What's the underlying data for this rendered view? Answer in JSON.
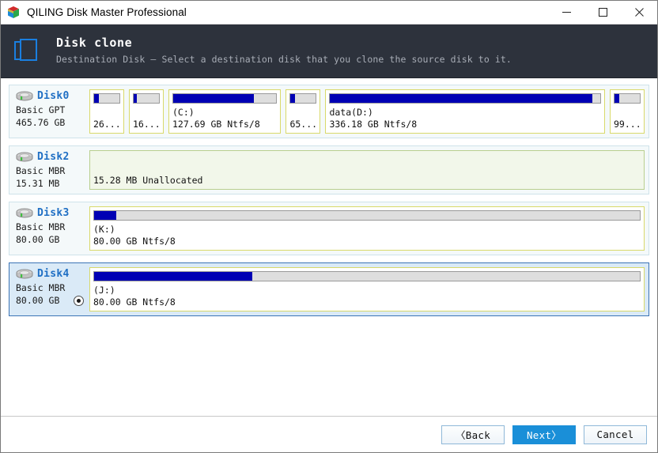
{
  "window": {
    "title": "QILING Disk Master Professional",
    "app_icon": "cube-icon",
    "controls": {
      "minimize": "minimize-icon",
      "maximize": "maximize-icon",
      "close": "close-icon"
    }
  },
  "header": {
    "icon": "disk-clone-icon",
    "title": "Disk clone",
    "subtitle": "Destination Disk – Select a destination disk that you clone the source disk to it."
  },
  "disks": [
    {
      "name": "Disk0",
      "type": "Basic GPT",
      "size": "465.76 GB",
      "selected": false,
      "has_radio": false,
      "partitions": [
        {
          "label": "",
          "size": "26...",
          "used_pct": 18,
          "truncated": true,
          "unallocated": false,
          "flex": "small"
        },
        {
          "label": "",
          "size": "16...",
          "used_pct": 14,
          "truncated": true,
          "unallocated": false,
          "flex": "small"
        },
        {
          "label": "(C:)",
          "size": "127.69 GB Ntfs/8",
          "used_pct": 78,
          "truncated": false,
          "unallocated": false,
          "flex": "3.2"
        },
        {
          "label": "",
          "size": "65...",
          "used_pct": 18,
          "truncated": true,
          "unallocated": false,
          "flex": "small"
        },
        {
          "label": "data(D:)",
          "size": "336.18 GB Ntfs/8",
          "used_pct": 97,
          "truncated": false,
          "unallocated": false,
          "flex": "8.3"
        },
        {
          "label": "",
          "size": "99...",
          "used_pct": 20,
          "truncated": true,
          "unallocated": false,
          "flex": "small"
        }
      ]
    },
    {
      "name": "Disk2",
      "type": "Basic MBR",
      "size": "15.31 MB",
      "selected": false,
      "has_radio": false,
      "partitions": [
        {
          "label": "",
          "size": "15.28 MB Unallocated",
          "used_pct": 0,
          "truncated": false,
          "unallocated": true,
          "flex": "1"
        }
      ]
    },
    {
      "name": "Disk3",
      "type": "Basic MBR",
      "size": "80.00 GB",
      "selected": false,
      "has_radio": false,
      "partitions": [
        {
          "label": "(K:)",
          "size": "80.00 GB Ntfs/8",
          "used_pct": 4,
          "truncated": false,
          "unallocated": false,
          "flex": "1"
        }
      ]
    },
    {
      "name": "Disk4",
      "type": "Basic MBR",
      "size": "80.00 GB",
      "selected": true,
      "has_radio": true,
      "partitions": [
        {
          "label": "(J:)",
          "size": "80.00 GB Ntfs/8",
          "used_pct": 29,
          "truncated": false,
          "unallocated": false,
          "flex": "1"
        }
      ]
    }
  ],
  "footer": {
    "back_label": "〈Back",
    "next_label": "Next〉",
    "cancel_label": "Cancel"
  },
  "colors": {
    "header_bg": "#2d323c",
    "accent_blue": "#1a8fd8",
    "disk_name": "#1f6fc4",
    "bar_fill": "#0000b4",
    "selection_bg": "#daeaf7",
    "selection_border": "#3b74b5"
  }
}
